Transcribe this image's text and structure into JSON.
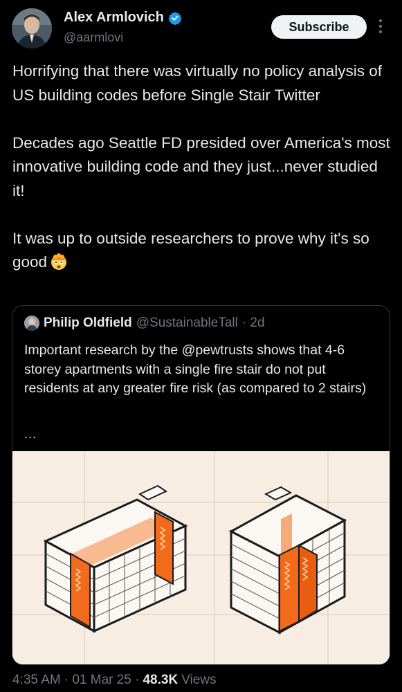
{
  "author": {
    "display_name": "Alex Armlovich",
    "handle": "@aarmlovi",
    "verified_icon": "verified-badge-icon",
    "accent": "#1d9bf0"
  },
  "subscribe_label": "Subscribe",
  "tweet": {
    "paragraph_1": "Horrifying that there was virtually no policy analysis of US building codes before Single Stair Twitter",
    "paragraph_2": "Decades ago Seattle FD presided over America's most innovative building code and they just...never studied it!",
    "paragraph_3": "It was up to outside researchers to prove why it's so good",
    "emoji": "exploding-head-emoji"
  },
  "quote": {
    "display_name": "Philip Oldfield",
    "handle": "@SustainableTall",
    "time": "· 2d",
    "text": "Important research by the @pewtrusts shows that 4-6 storey apartments with a single fire stair do not put residents at any greater fire risk (as compared to 2 stairs)",
    "more": "...",
    "image": "single-stair-vs-double-stair-building-illustration"
  },
  "footer": {
    "time": "4:35 AM",
    "date": "· 01 Mar 25 ·",
    "views_count": "48.3K",
    "views_label": "Views"
  }
}
